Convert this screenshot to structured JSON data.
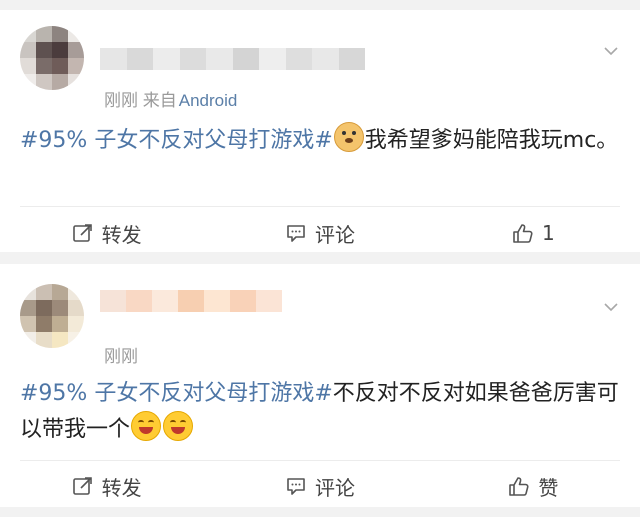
{
  "posts": [
    {
      "time": "刚刚",
      "source_prefix": "来自",
      "source": "Android",
      "topic": "#95% 子女不反对父母打游戏#",
      "body": "我希望爹妈能陪我玩mc。",
      "emoji": "doge-emoji",
      "actions": {
        "repost": "转发",
        "comment": "评论",
        "like": "1"
      }
    },
    {
      "time": "刚刚",
      "topic": "#95% 子女不反对父母打游戏#",
      "body": "不反对不反对如果爸爸厉害可以带我一个",
      "emoji": "laugh-emoji",
      "actions": {
        "repost": "转发",
        "comment": "评论",
        "like": "赞"
      }
    }
  ],
  "colors": {
    "topic": "#4e76a6",
    "meta": "#9a9a9a",
    "background": "#f2f2f2"
  }
}
